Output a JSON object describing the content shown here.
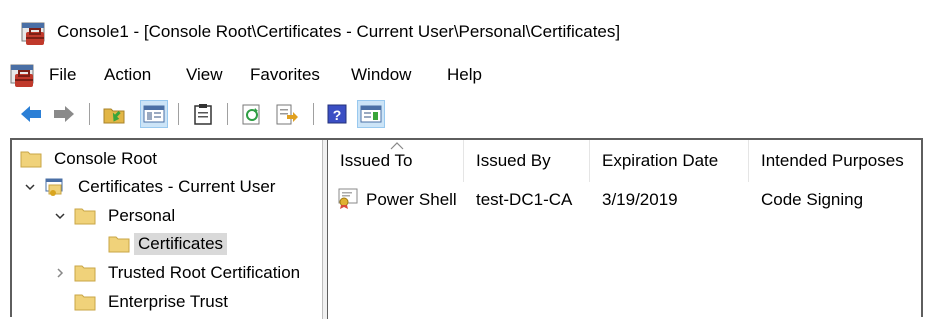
{
  "window": {
    "title": "Console1 - [Console Root\\Certificates - Current User\\Personal\\Certificates]"
  },
  "menu": {
    "items": [
      "File",
      "Action",
      "View",
      "Favorites",
      "Window",
      "Help"
    ]
  },
  "toolbar": {
    "buttons": [
      "back-arrow-icon",
      "forward-arrow-icon",
      "up-folder-icon",
      "show-hide-tree-icon",
      "clipboard-icon",
      "refresh-icon",
      "export-list-icon",
      "help-icon",
      "show-hide-action-pane-icon"
    ]
  },
  "tree": {
    "nodes": [
      {
        "label": "Console Root",
        "icon": "folder-icon"
      },
      {
        "label": "Certificates - Current User",
        "icon": "certificates-snapin-icon",
        "expanded": true
      },
      {
        "label": "Personal",
        "icon": "folder-icon",
        "expanded": true
      },
      {
        "label": "Certificates",
        "icon": "folder-icon",
        "selected": true
      },
      {
        "label": "Trusted Root Certification",
        "icon": "folder-icon",
        "expanded": false
      },
      {
        "label": "Enterprise Trust",
        "icon": "folder-icon"
      }
    ]
  },
  "list": {
    "columns": [
      "Issued To",
      "Issued By",
      "Expiration Date",
      "Intended Purposes"
    ],
    "rows": [
      {
        "issued_to": "Power Shell",
        "issued_by": "test-DC1-CA",
        "expiration": "3/19/2019",
        "purposes": "Code Signing",
        "icon": "certificate-icon"
      }
    ]
  },
  "colors": {
    "pressed_button": "#cce4f7",
    "selected_item": "#d9d9d9",
    "folder": "#f0d27a"
  }
}
